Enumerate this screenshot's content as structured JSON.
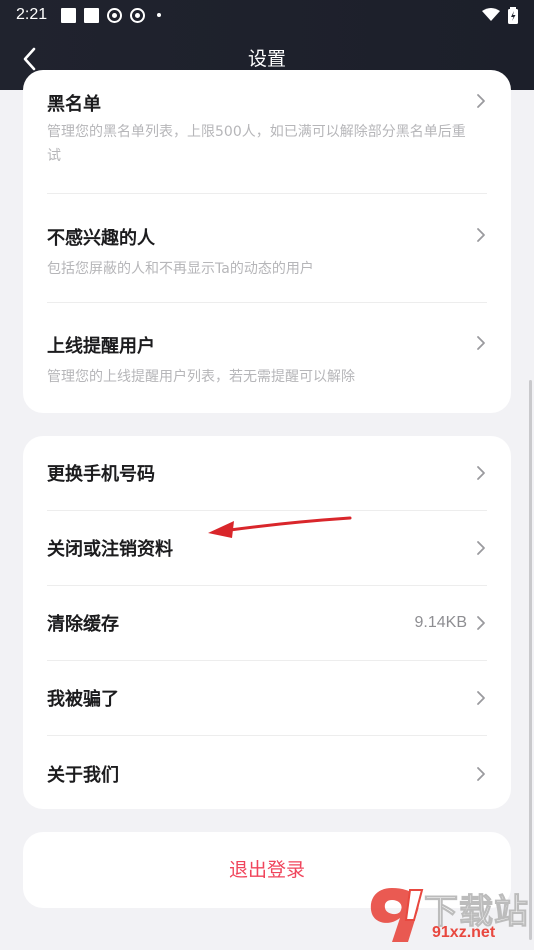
{
  "status_bar": {
    "time": "2:21"
  },
  "header": {
    "title": "设置"
  },
  "card1": {
    "items": [
      {
        "title": "黑名单",
        "desc": "管理您的黑名单列表，上限500人，如已满可以解除部分黑名单后重试"
      },
      {
        "title": "不感兴趣的人",
        "desc": "包括您屏蔽的人和不再显示Ta的动态的用户"
      },
      {
        "title": "上线提醒用户",
        "desc": "管理您的上线提醒用户列表，若无需提醒可以解除"
      }
    ]
  },
  "card2": {
    "rows": [
      {
        "title": "更换手机号码",
        "value": ""
      },
      {
        "title": "关闭或注销资料",
        "value": ""
      },
      {
        "title": "清除缓存",
        "value": "9.14KB"
      },
      {
        "title": "我被骗了",
        "value": ""
      },
      {
        "title": "关于我们",
        "value": ""
      }
    ]
  },
  "logout": {
    "label": "退出登录"
  },
  "watermark": {
    "brand": "下载站",
    "url": "91xz.net"
  },
  "colors": {
    "header_bg": "#1e212c",
    "logout_text": "#f0455c",
    "page_bg": "#f2f2f5",
    "annotation_arrow": "#d9262b"
  }
}
